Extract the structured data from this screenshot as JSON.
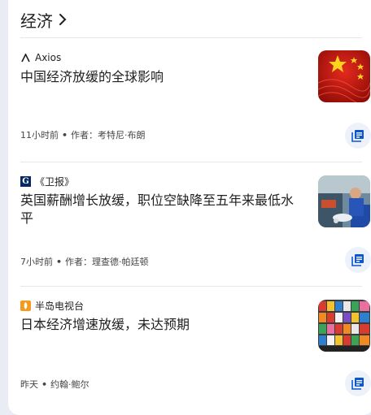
{
  "section": {
    "title": "经济"
  },
  "articles": [
    {
      "source": "Axios",
      "title": "中国经济放缓的全球影响",
      "time": "11小时前",
      "author": "作者：考特尼·布朗"
    },
    {
      "source": "《卫报》",
      "title": "英国薪酬增长放缓，职位空缺降至五年来最低水平",
      "time": "7小时前",
      "author": "作者：理查德·帕廷顿"
    },
    {
      "source": "半岛电视台",
      "title": "日本经济增速放缓，未达预期",
      "time": "昨天",
      "author": "约翰·鲍尔"
    }
  ],
  "colors": {
    "accent": "#0b57d0",
    "button_bg": "#edf2fa"
  },
  "icons": {
    "section_chevron": "chevron-right-icon",
    "full_coverage": "full-coverage-icon"
  }
}
